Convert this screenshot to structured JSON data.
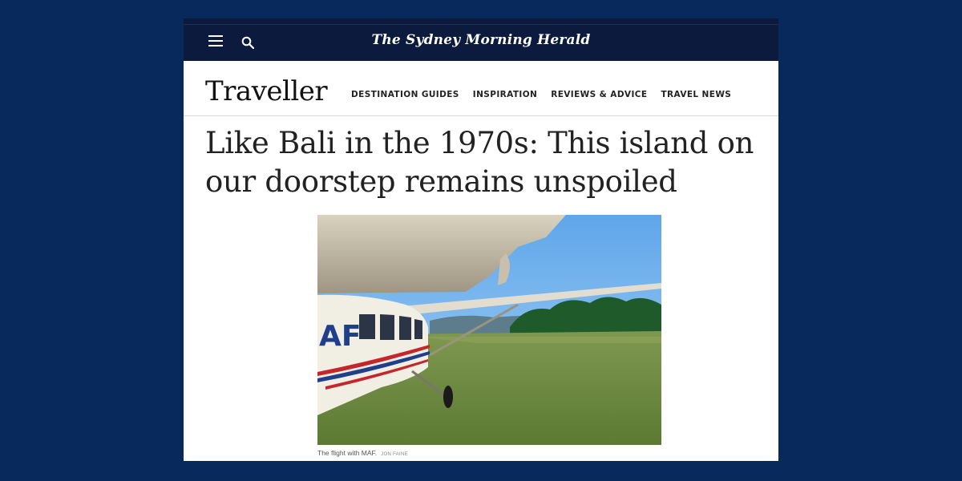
{
  "masthead": {
    "title": "The Sydney Morning Herald"
  },
  "icons": {
    "menu": "hamburger-menu-icon",
    "search": "search-icon"
  },
  "section": {
    "brand": "Traveller"
  },
  "nav": {
    "items": [
      {
        "label": "DESTINATION GUIDES"
      },
      {
        "label": "INSPIRATION"
      },
      {
        "label": "REVIEWS & ADVICE"
      },
      {
        "label": "TRAVEL NEWS"
      }
    ]
  },
  "article": {
    "headline": "Like Bali in the 1970s: This island on our doorstep remains unspoiled",
    "image": {
      "plane_livery_text": "AF"
    },
    "caption": "The flight with MAF.",
    "credit": "JON FAINE"
  },
  "colors": {
    "page_background": "#07295b",
    "topbar": "#0c1b3d",
    "text": "#222222",
    "sky": "#7fb8ee",
    "grass": "#6f8a3f",
    "livery_blue": "#1f3e8c",
    "livery_red": "#c5262c"
  }
}
